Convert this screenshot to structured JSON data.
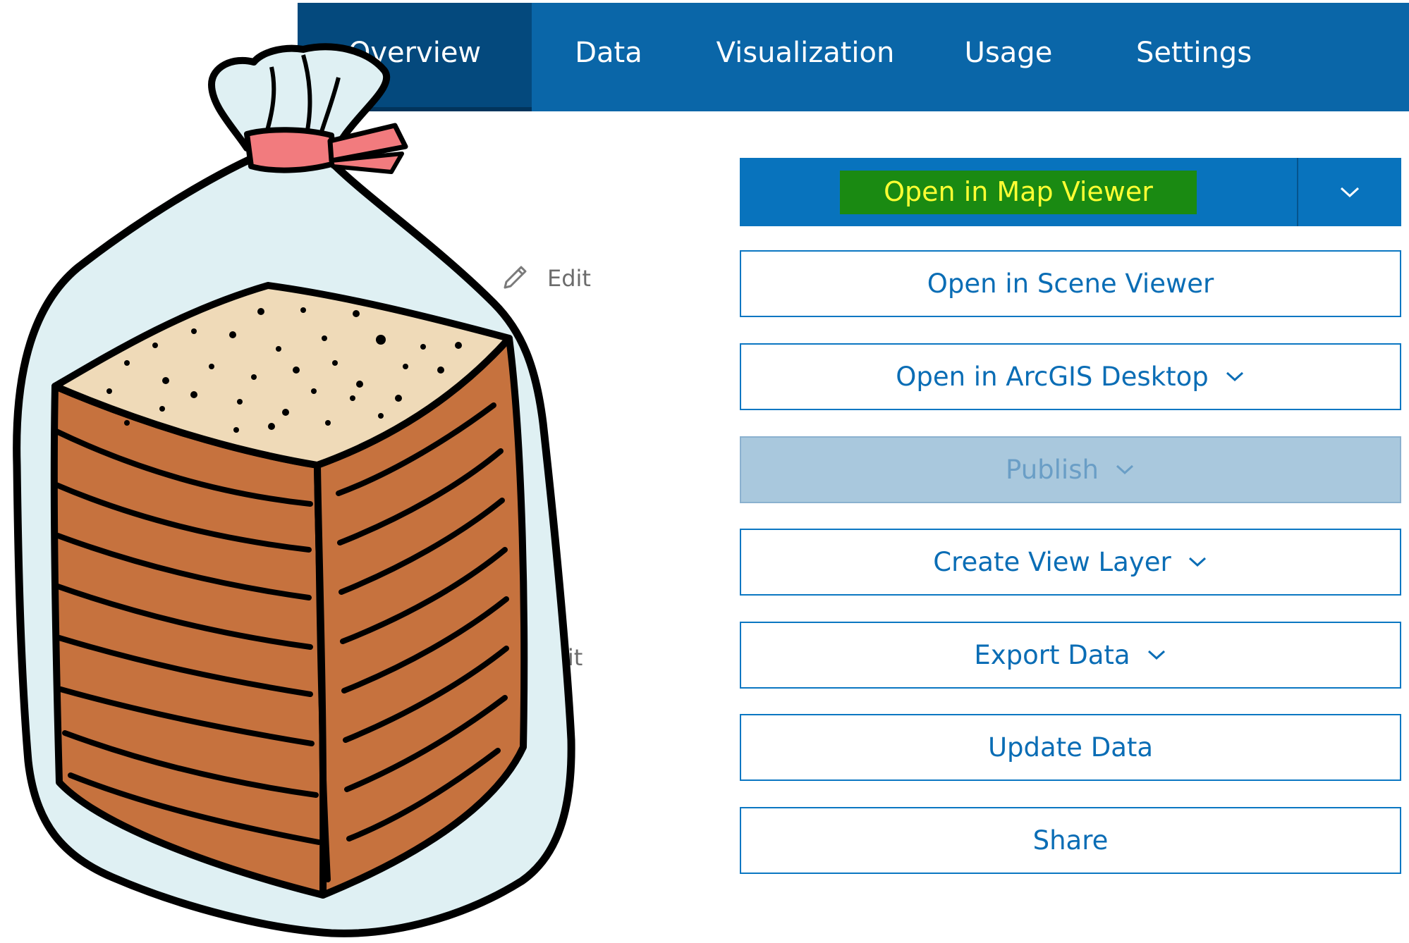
{
  "tabs": [
    {
      "label": "Overview",
      "active": true
    },
    {
      "label": "Data",
      "active": false
    },
    {
      "label": "Visualization",
      "active": false
    },
    {
      "label": "Usage",
      "active": false
    },
    {
      "label": "Settings",
      "active": false
    }
  ],
  "edit_links": {
    "first": "Edit",
    "second_partial": "lit"
  },
  "actions": {
    "open_map_viewer": "Open in Map Viewer",
    "open_scene_viewer": "Open in Scene Viewer",
    "open_arcgis_desktop": "Open in ArcGIS Desktop",
    "publish": "Publish",
    "create_view_layer": "Create View Layer",
    "export_data": "Export Data",
    "update_data": "Update Data",
    "share": "Share"
  },
  "icons": {
    "dropdown": "chevron-down-icon",
    "edit": "pencil-icon",
    "overlay": "bread-bag-illustration"
  },
  "colors": {
    "tab_bar": "#0a66a8",
    "tab_active": "#04497d",
    "primary_button": "#0873bd",
    "highlight_bg": "#1a8a12",
    "highlight_text": "#ffff33",
    "button_border": "#0b77c2",
    "disabled_button": "#a9c8dd"
  }
}
